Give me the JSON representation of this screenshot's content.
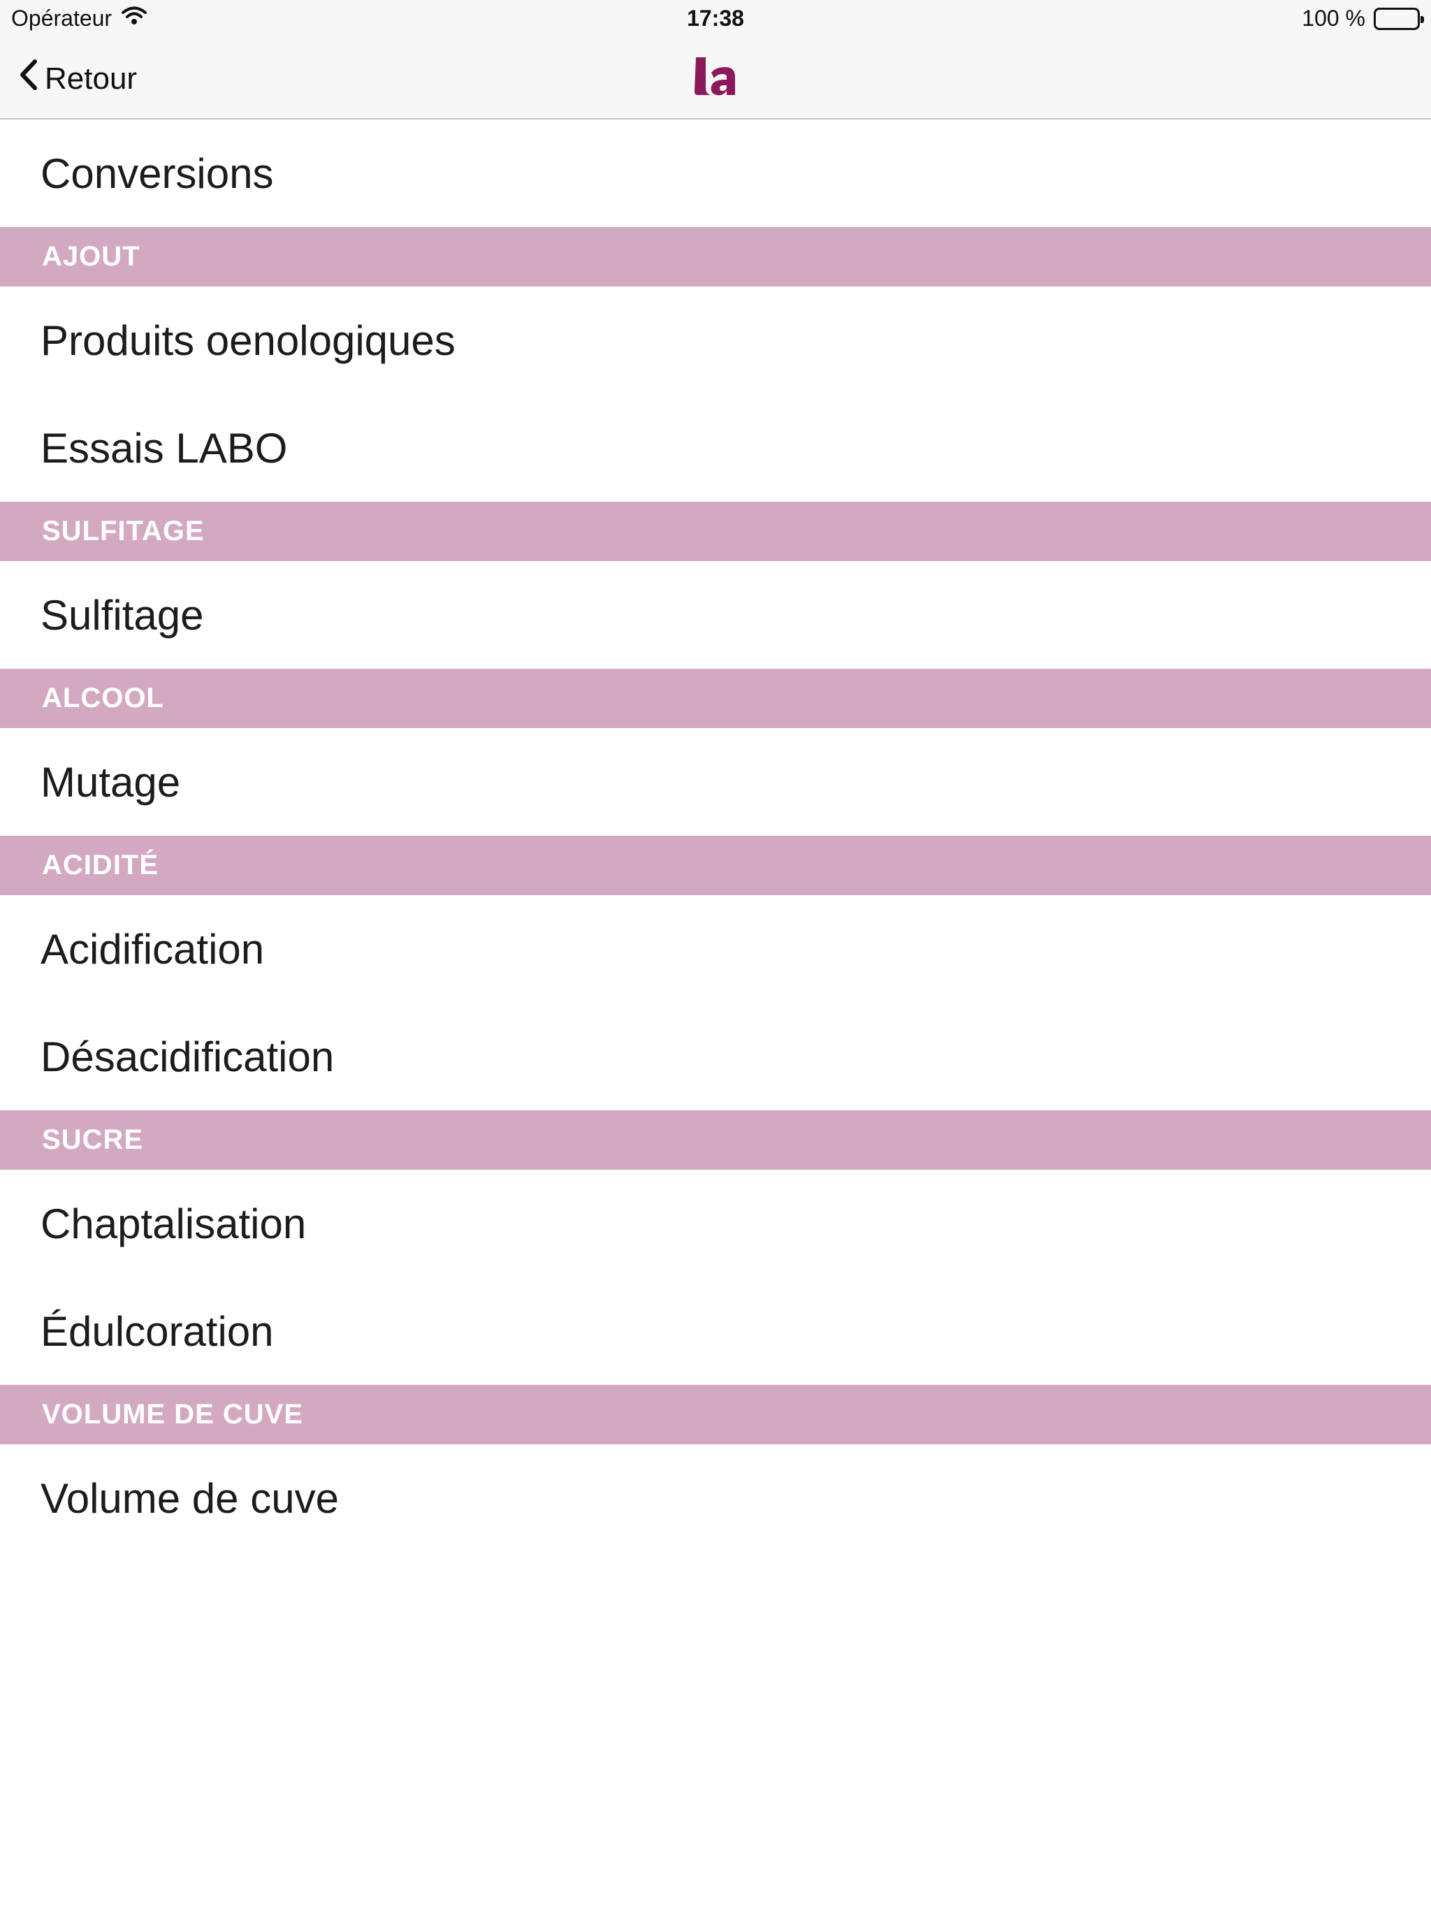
{
  "status_bar": {
    "carrier": "Opérateur",
    "time": "17:38",
    "battery_text": "100 %",
    "battery_level": 1.0
  },
  "nav": {
    "back_label": "Retour",
    "logo_icon": "la-logo-icon",
    "logo_color": "#8b1a5c"
  },
  "colors": {
    "section_bg": "#d2a9c1",
    "section_text": "#ffffff"
  },
  "list": {
    "top_item": "Conversions",
    "sections": [
      {
        "header": "AJOUT",
        "items": [
          "Produits oenologiques",
          "Essais LABO"
        ]
      },
      {
        "header": "SULFITAGE",
        "items": [
          "Sulfitage"
        ]
      },
      {
        "header": "ALCOOL",
        "items": [
          "Mutage"
        ]
      },
      {
        "header": "ACIDITÉ",
        "items": [
          "Acidification",
          "Désacidification"
        ]
      },
      {
        "header": "SUCRE",
        "items": [
          "Chaptalisation",
          "Édulcoration"
        ]
      },
      {
        "header": "VOLUME DE CUVE",
        "items": [
          "Volume de cuve"
        ]
      }
    ]
  }
}
